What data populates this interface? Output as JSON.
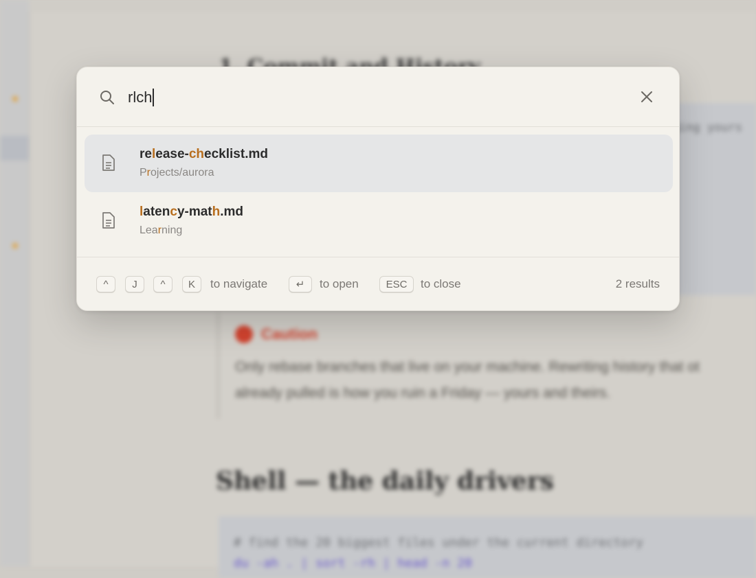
{
  "background": {
    "section_heading": "1. Commit and History",
    "code_snippet_1": "(aging yours",
    "callout_label": "Caution",
    "callout_text_line1": "Only rebase branches that live on your machine. Rewriting history that ot",
    "callout_text_line2": "already pulled is how you ruin a Friday — yours and theirs.",
    "section_heading_2": "Shell — the daily drivers",
    "code_comment": "# find the 20 biggest files under the current directory",
    "code_line": "du -ah . | sort -rh | head -n 20"
  },
  "palette": {
    "query": "rlch",
    "results": [
      {
        "title_segments": [
          {
            "t": "re",
            "h": false
          },
          {
            "t": "l",
            "h": true
          },
          {
            "t": "ease-",
            "h": false
          },
          {
            "t": "ch",
            "h": true
          },
          {
            "t": "ecklist.md",
            "h": false
          }
        ],
        "path_segments": [
          {
            "t": "P",
            "h": false
          },
          {
            "t": "r",
            "h": true
          },
          {
            "t": "ojects/aurora",
            "h": false
          }
        ],
        "selected": true,
        "icon": "document-icon"
      },
      {
        "title_segments": [
          {
            "t": "l",
            "h": true
          },
          {
            "t": "aten",
            "h": false
          },
          {
            "t": "c",
            "h": true
          },
          {
            "t": "y-mat",
            "h": false
          },
          {
            "t": "h",
            "h": true
          },
          {
            "t": ".md",
            "h": false
          }
        ],
        "path_segments": [
          {
            "t": "Lea",
            "h": false
          },
          {
            "t": "r",
            "h": true
          },
          {
            "t": "ning",
            "h": false
          }
        ],
        "selected": false,
        "icon": "document-icon"
      }
    ],
    "footer": {
      "key_ctrl_1": "^",
      "key_j": "J",
      "key_ctrl_2": "^",
      "key_k": "K",
      "navigate_hint": "to navigate",
      "key_enter": "↵",
      "open_hint": "to open",
      "key_esc": "ESC",
      "close_hint": "to close",
      "result_count": "2 results"
    },
    "highlight_color": "#b86e1e"
  }
}
